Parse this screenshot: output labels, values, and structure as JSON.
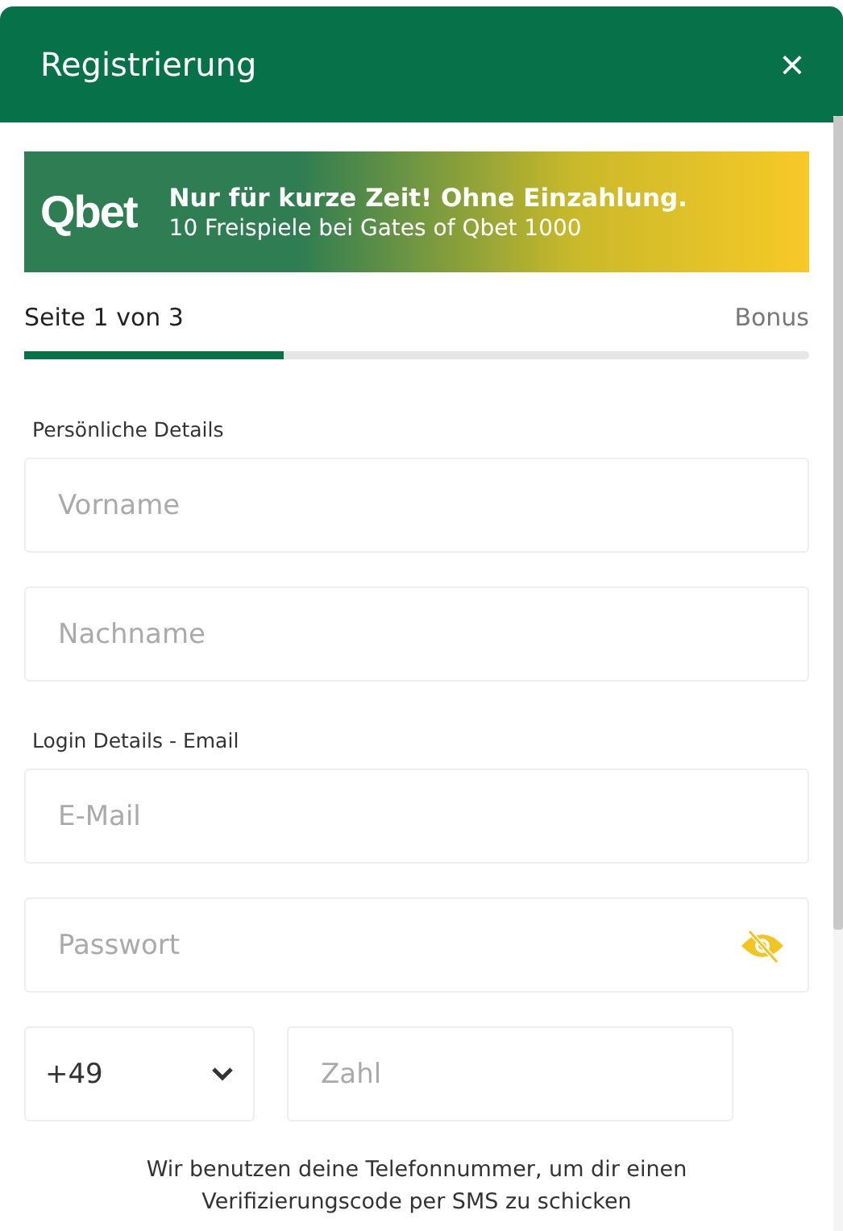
{
  "window": {
    "title": "Registrierung",
    "close": "×"
  },
  "banner": {
    "logo": "Qbet",
    "headline": "Nur für kurze Zeit! Ohne Einzahlung.",
    "subline": "10 Freispiele bei Gates of Qbet 1000"
  },
  "progress": {
    "step": "Seite 1 von 3",
    "next": "Bonus",
    "level": 0.33
  },
  "sections": [
    {
      "label": "Persönliche Details",
      "fields": [
        {
          "placeholder": "Vorname",
          "kind": "text"
        },
        {
          "placeholder": "Nachname",
          "kind": "text"
        }
      ]
    },
    {
      "label": "Login Details - Email",
      "fields": [
        {
          "placeholder": "E-Mail",
          "kind": "text"
        },
        {
          "placeholder": "Passwort",
          "kind": "password"
        }
      ]
    }
  ],
  "phone": {
    "code": "+49",
    "placeholder": "Zahl"
  },
  "note": "Wir benutzen deine Telefonnummer, um dir einen Verifizierungscode per SMS zu schicken"
}
